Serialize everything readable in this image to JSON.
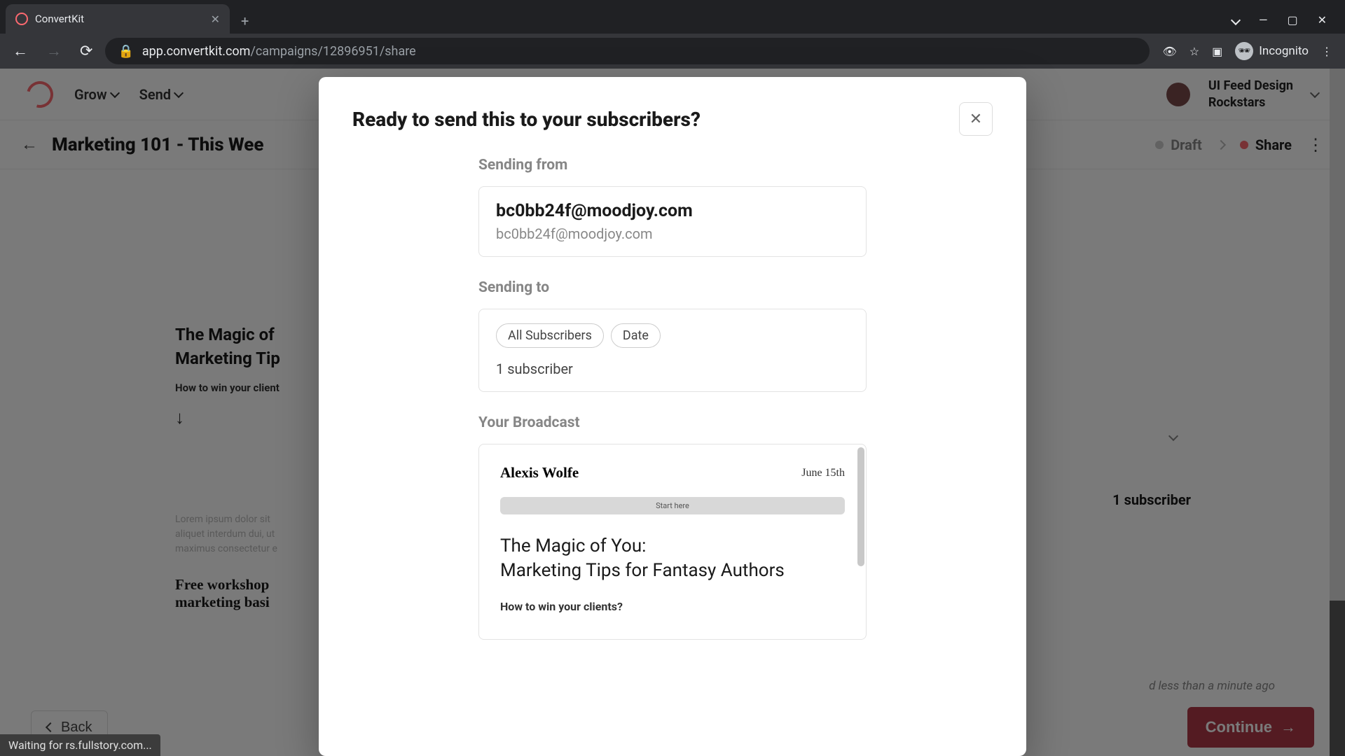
{
  "browser": {
    "tab_title": "ConvertKit",
    "url_prefix": "app.convertkit.com",
    "url_path": "/campaigns/12896951/share",
    "incognito_label": "Incognito"
  },
  "app": {
    "nav": {
      "grow": "Grow",
      "send": "Send"
    },
    "account_line1": "UI Feed Design",
    "account_line2": "Rockstars"
  },
  "page": {
    "title": "Marketing 101 - This Wee",
    "step_draft": "Draft",
    "step_share": "Share"
  },
  "preview": {
    "h1_line1": "The Magic of",
    "h1_line2": "Marketing Tip",
    "sub": "How to win your client",
    "lorem1": "Lorem ipsum dolor sit",
    "lorem2": "aliquet interdum dui, ut",
    "lorem3": "maximus consectetur e",
    "workshop1": "Free workshop",
    "workshop2": "marketing basi"
  },
  "sidebar": {
    "subscriber_count": "1 subscriber",
    "saved_text": "d less than a minute ago"
  },
  "buttons": {
    "back": "Back",
    "continue": "Continue"
  },
  "modal": {
    "title": "Ready to send this to your subscribers?",
    "sending_from_label": "Sending from",
    "from_name": "bc0bb24f@moodjoy.com",
    "from_email": "bc0bb24f@moodjoy.com",
    "sending_to_label": "Sending to",
    "tags": {
      "all": "All Subscribers",
      "date": "Date"
    },
    "subscriber_count": "1 subscriber",
    "broadcast_label": "Your Broadcast",
    "broadcast": {
      "author": "Alexis Wolfe",
      "date": "June 15th",
      "pill": "Start here",
      "title_line1": "The Magic of You:",
      "title_line2": "Marketing Tips for Fantasy Authors",
      "sub": "How to win your clients?"
    }
  },
  "status": "Waiting for rs.fullstory.com..."
}
